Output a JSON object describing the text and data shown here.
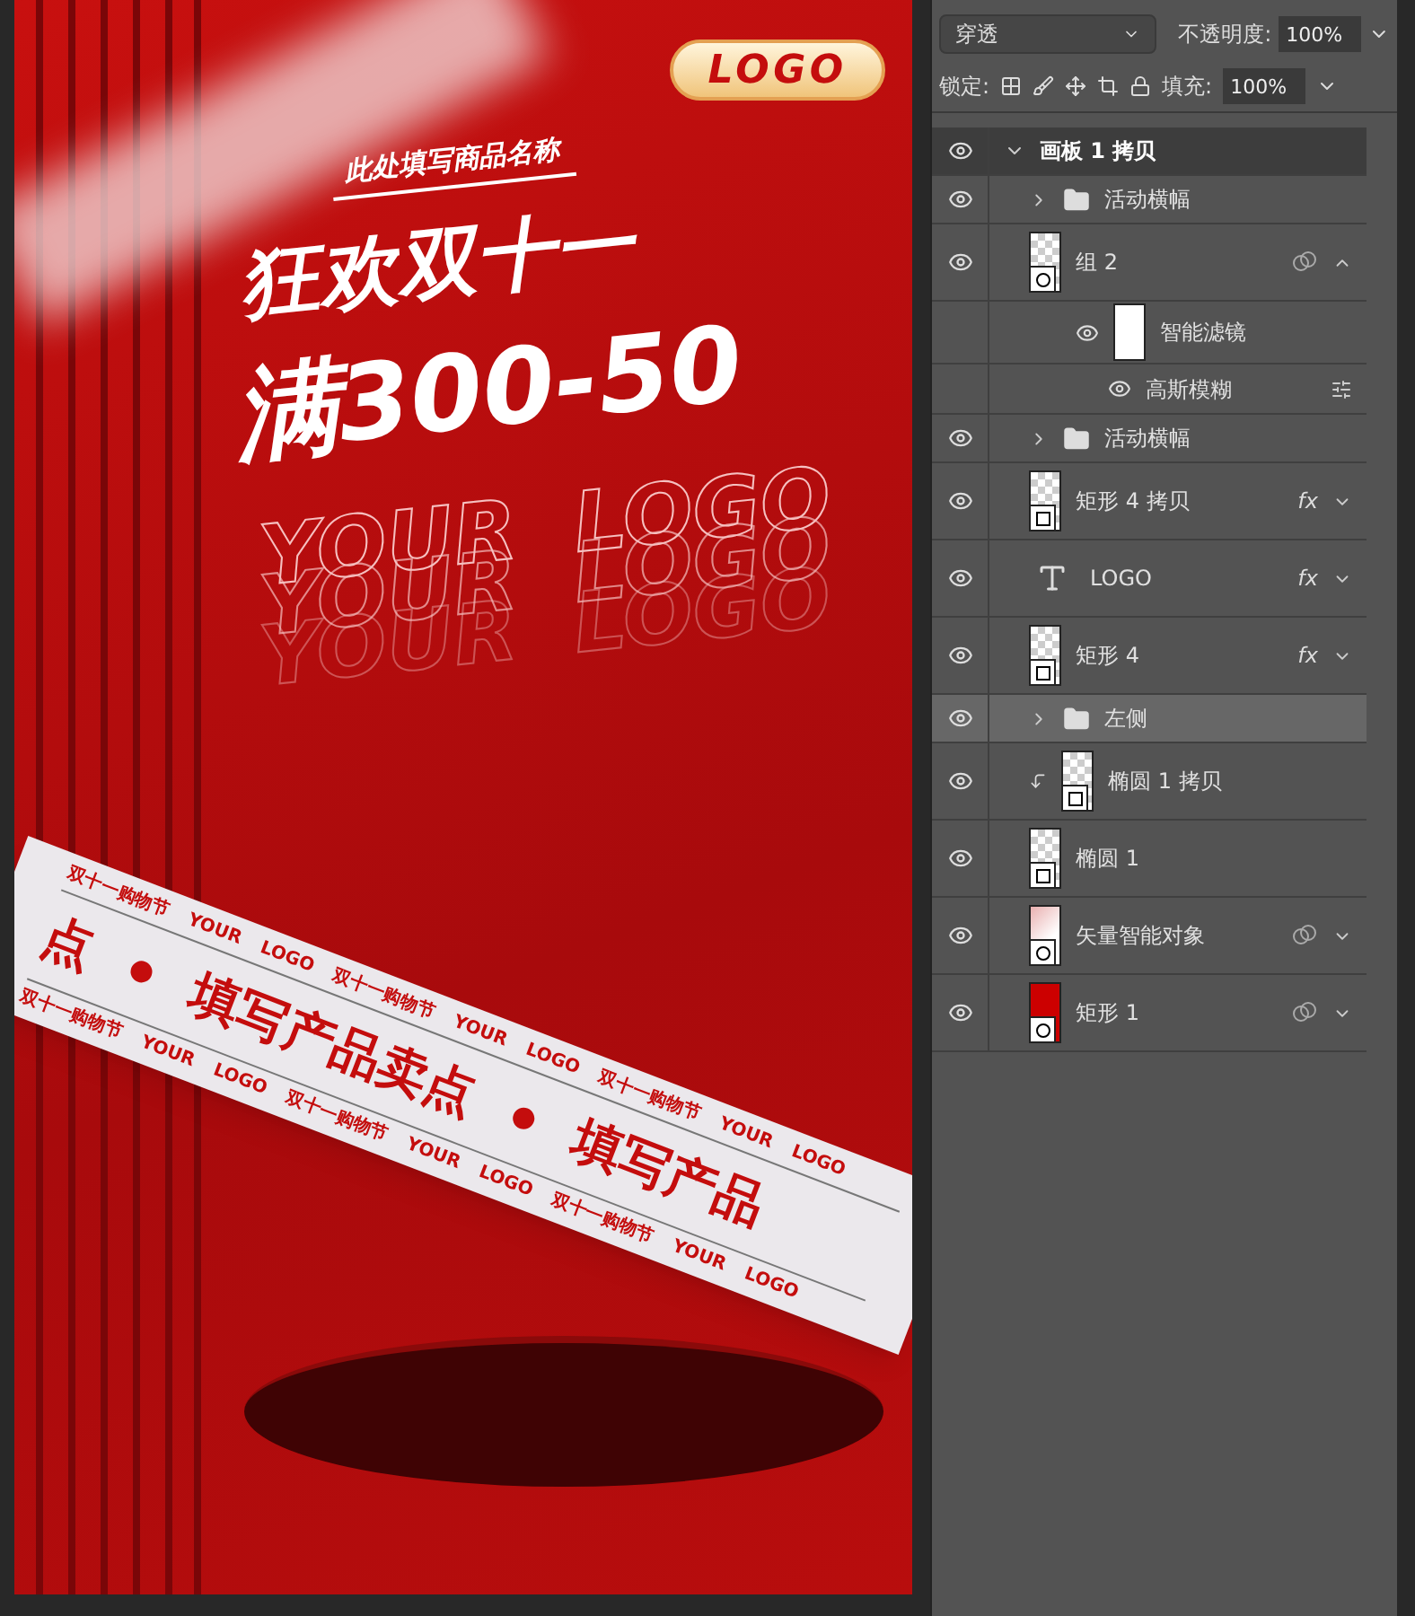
{
  "poster": {
    "logo_badge": "LOGO",
    "subtitle": "此处填写商品名称",
    "headline": "狂欢双十一",
    "offer": "满300-50",
    "watermark_lines": [
      {
        "left": "YOUR",
        "right": "LOGO"
      },
      {
        "left": "YOUR",
        "right": "LOGO"
      },
      {
        "left": "YOUR",
        "right": "LOGO"
      }
    ],
    "banner": {
      "main": [
        "点",
        "填写产品卖点",
        "填写产品"
      ],
      "strips": [
        [
          "双十一购物节",
          "YOUR",
          "LOGO",
          "双十一购物节",
          "YOUR",
          "LOGO",
          "双十一购物节",
          "YOUR",
          "LOGO"
        ],
        [
          "双十一购物节",
          "YOUR",
          "LOGO",
          "双十一购物节",
          "YOUR",
          "LOGO",
          "双十一购物节",
          "YOUR",
          "LOGO"
        ]
      ]
    }
  },
  "panel": {
    "blend_mode": "穿透",
    "opacity_label": "不透明度:",
    "opacity": "100%",
    "lock_label": "锁定:",
    "fill_label": "填充:",
    "fill": "100%"
  },
  "layers": [
    {
      "kind": "artboard",
      "name": "画板 1 拷贝",
      "visible": true,
      "selected": false,
      "expanded": true,
      "children": [
        {
          "kind": "folder",
          "name": "活动横幅",
          "visible": true,
          "selected": false,
          "expanded": false
        },
        {
          "kind": "smart",
          "name": "组 2",
          "visible": true,
          "selected": false,
          "expanded": true,
          "clipped": false,
          "children": [
            {
              "kind": "filter",
              "name": "智能滤镜",
              "visible": true,
              "selected": false,
              "children": [
                {
                  "kind": "effect",
                  "name": "高斯模糊",
                  "visible": true,
                  "selected": false
                }
              ]
            }
          ]
        },
        {
          "kind": "folder",
          "name": "活动横幅",
          "visible": true,
          "selected": false,
          "expanded": false
        },
        {
          "kind": "shape",
          "name": "矩形 4 拷贝",
          "fx": "fx",
          "visible": true,
          "selected": false,
          "expanded": false,
          "clipped": false
        },
        {
          "kind": "text",
          "name": "LOGO",
          "fx": "fx",
          "visible": true,
          "selected": false,
          "expanded": false
        },
        {
          "kind": "shape",
          "name": "矩形 4",
          "fx": "fx",
          "visible": true,
          "selected": false,
          "expanded": false,
          "clipped": false
        },
        {
          "kind": "folder",
          "name": "左侧",
          "visible": true,
          "selected": true,
          "expanded": false
        },
        {
          "kind": "shape",
          "name": "椭圆 1 拷贝",
          "visible": true,
          "selected": false,
          "clipped": true
        },
        {
          "kind": "shape",
          "name": "椭圆 1",
          "visible": true,
          "selected": false,
          "clipped": false
        },
        {
          "kind": "smart-pattern",
          "name": "矢量智能对象",
          "visible": true,
          "selected": false,
          "expanded": false,
          "clipped": false
        },
        {
          "kind": "smart-red",
          "name": "矩形 1",
          "visible": true,
          "selected": false,
          "expanded": false,
          "clipped": false
        }
      ]
    }
  ]
}
